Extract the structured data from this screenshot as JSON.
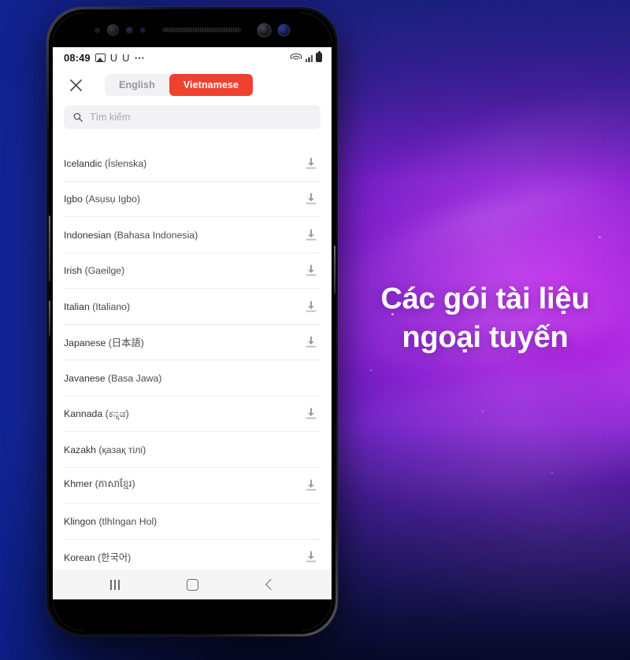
{
  "background": {
    "gradient_from": "#1b38b4",
    "gradient_to": "#c020e8",
    "accent_glow": "#e24eff"
  },
  "promo": {
    "headline_line1": "Các gói tài liệu",
    "headline_line2": "ngoại tuyến"
  },
  "phone": {
    "statusbar": {
      "time": "08:49",
      "icons_left": [
        "image-icon",
        "u-icon",
        "u-icon",
        "overflow-dots-icon"
      ],
      "u_glyph": "U",
      "dots_glyph": "⋯",
      "icons_right": [
        "wifi-icon",
        "signal-icon",
        "battery-icon"
      ]
    },
    "navbar": {
      "recents_label": "Recents",
      "home_label": "Home",
      "back_label": "Back"
    }
  },
  "app": {
    "close_label": "×",
    "accent_color": "#f0412f",
    "language_tabs": [
      {
        "label": "English",
        "active": false
      },
      {
        "label": "Vietnamese",
        "active": true
      }
    ],
    "search": {
      "placeholder": "Tìm kiếm",
      "value": ""
    },
    "languages": [
      {
        "name": "Icelandic",
        "native": "(Íslenska)",
        "downloadable": true
      },
      {
        "name": "Igbo",
        "native": "(Asụsụ Igbo)",
        "downloadable": true
      },
      {
        "name": "Indonesian",
        "native": "(Bahasa Indonesia)",
        "downloadable": true
      },
      {
        "name": "Irish",
        "native": "(Gaeilge)",
        "downloadable": true
      },
      {
        "name": "Italian",
        "native": "(Italiano)",
        "downloadable": true
      },
      {
        "name": "Japanese",
        "native": "(日本語)",
        "downloadable": true
      },
      {
        "name": "Javanese",
        "native": "(Basa Jawa)",
        "downloadable": false
      },
      {
        "name": "Kannada",
        "native": "(ಕನ್ನಡ)",
        "downloadable": true
      },
      {
        "name": "Kazakh",
        "native": "(қазақ тілі)",
        "downloadable": false
      },
      {
        "name": "Khmer",
        "native": "(ភាសាខ្មែរ)",
        "downloadable": true
      },
      {
        "name": "Klingon",
        "native": "(tlhIngan Hol)",
        "downloadable": false
      },
      {
        "name": "Korean",
        "native": "(한국어)",
        "downloadable": true
      }
    ]
  }
}
